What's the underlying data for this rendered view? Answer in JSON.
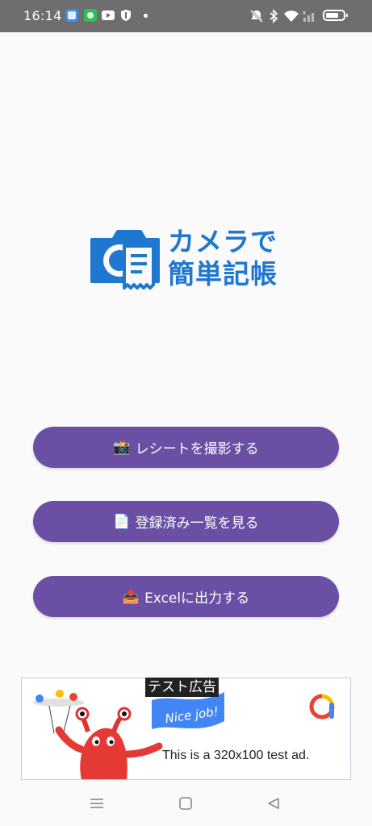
{
  "status_bar": {
    "time": "16:14",
    "icons": [
      "app-icon-blue",
      "app-icon-green",
      "youtube-icon",
      "shield-icon",
      "notification-dot",
      "mute-icon",
      "bluetooth-icon",
      "wifi-icon",
      "signal-icon",
      "battery-icon"
    ]
  },
  "logo": {
    "line1": "カメラで",
    "line2": "簡単記帳",
    "color": "#1f77d0"
  },
  "buttons": [
    {
      "emoji": "📸",
      "label": "レシートを撮影する"
    },
    {
      "emoji": "📄",
      "label": "登録済み一覧を見る"
    },
    {
      "emoji": "📤",
      "label": "Excelに出力する"
    }
  ],
  "ad": {
    "label": "テスト広告",
    "banner_text": "Nice job!",
    "text": "This is a 320x100 test ad."
  },
  "nav": {
    "icons": [
      "menu-icon",
      "home-icon",
      "back-icon"
    ]
  },
  "colors": {
    "button": "#6a4fa5",
    "status_bar": "#6e6e6e",
    "background": "#fafafa"
  }
}
